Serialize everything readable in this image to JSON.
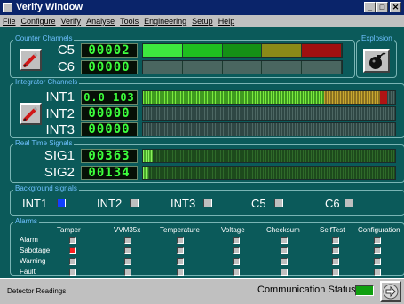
{
  "window": {
    "title": "Verify Window",
    "buttons": [
      "_",
      "□",
      "✕"
    ]
  },
  "menu": [
    "File",
    "Configure",
    "Verify",
    "Analyse",
    "Tools",
    "Engineering",
    "Setup",
    "Help"
  ],
  "counter": {
    "label": "Counter Channels",
    "channels": [
      {
        "name": "C5",
        "value": "00002"
      },
      {
        "name": "C6",
        "value": "00000"
      }
    ],
    "bar_colors": [
      "#3ee83e",
      "#1fbf1f",
      "#159015",
      "#8a8a18",
      "#a01010"
    ]
  },
  "explosion": {
    "label": "Explosion",
    "icon": "bomb-icon"
  },
  "integrator": {
    "label": "Integrator Channels",
    "channels": [
      {
        "name": "INT1",
        "value": "0.0 103"
      },
      {
        "name": "INT2",
        "value": "00000"
      },
      {
        "name": "INT3",
        "value": "00000"
      }
    ],
    "int1_fill": 0.97
  },
  "realtime": {
    "label": "Real Time Signals",
    "channels": [
      {
        "name": "SIG1",
        "value": "00363"
      },
      {
        "name": "SIG2",
        "value": "00134"
      }
    ],
    "fills": [
      0.04,
      0.02
    ]
  },
  "background": {
    "label": "Background signals",
    "items": [
      {
        "name": "INT1",
        "active": true
      },
      {
        "name": "INT2",
        "active": false
      },
      {
        "name": "INT3",
        "active": false
      },
      {
        "name": "C5",
        "active": false
      },
      {
        "name": "C6",
        "active": false
      }
    ]
  },
  "alarms": {
    "label": "Alarms",
    "columns": [
      "Tamper",
      "VVM35x",
      "Temperature",
      "Voltage",
      "Checksum",
      "SelfTest",
      "Configuration"
    ],
    "rows": [
      "Alarm",
      "Sabotage",
      "Warning",
      "Fault"
    ],
    "active": [
      {
        "row": 1,
        "col": 0,
        "color": "#ff2020"
      }
    ]
  },
  "status": {
    "left": "Detector Readings",
    "comm_label": "Communication Status:",
    "comm_color": "#10a010"
  },
  "icons": {
    "edit": "pencil-edit-icon",
    "next": "arrow-right-icon",
    "app": "app-icon"
  }
}
